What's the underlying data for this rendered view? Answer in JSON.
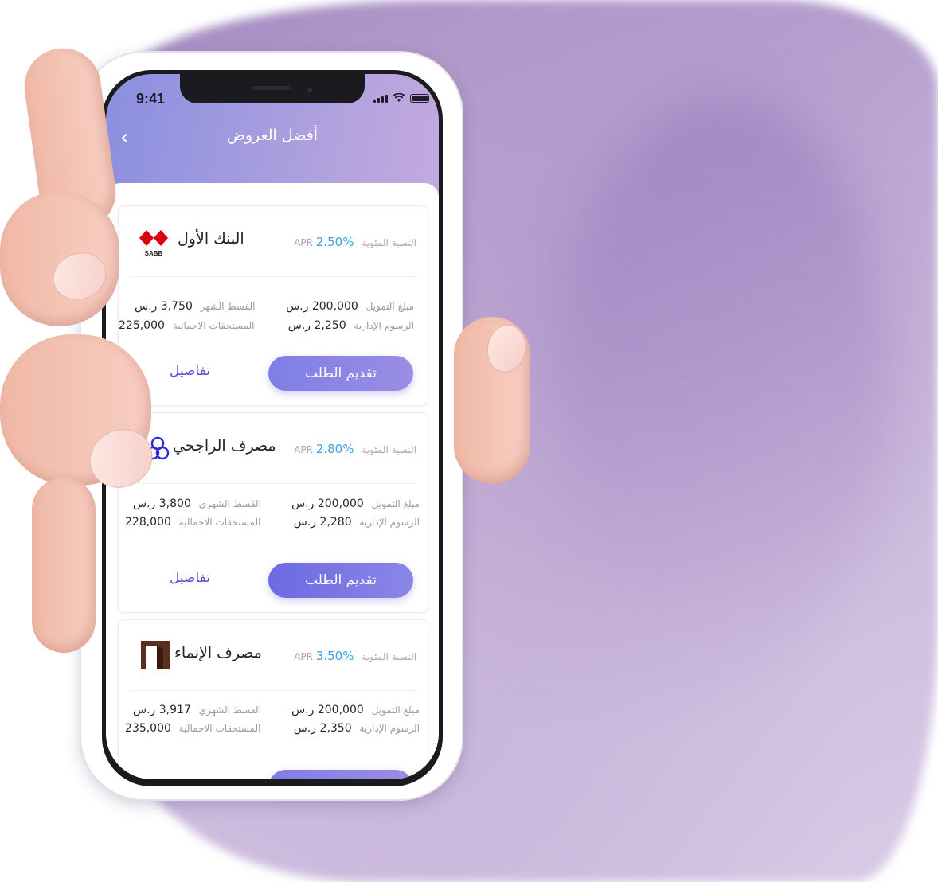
{
  "status_bar": {
    "time": "9:41"
  },
  "header": {
    "title": "أفضل العروض"
  },
  "offers": [
    {
      "bank_name": "البنك الأول",
      "logo_text": "SABB",
      "logo_color": "#db0011",
      "apr_label": "النسبة المئوية APR",
      "apr_value": "2.50%",
      "finance_label": "مبلغ التمويل",
      "finance_value": "200,000 ر.س",
      "admin_fee_label": "الرسوم الإدارية",
      "admin_fee_value": "2,250 ر.س",
      "monthly_label": "القسط الشهر",
      "monthly_value": "3,750 ر.س",
      "total_label": "المستحقات الاجمالية",
      "total_value": "225,000",
      "apply_label": "تقديم الطلب",
      "details_label": "تفاصيل"
    },
    {
      "bank_name": "مصرف الراجحي",
      "logo_color": "#2b2ad6",
      "apr_label": "النسبة المئوية APR",
      "apr_value": "2.80%",
      "finance_label": "مبلغ التمويل",
      "finance_value": "200,000 ر.س",
      "admin_fee_label": "الرسوم الإدارية",
      "admin_fee_value": "2,280 ر.س",
      "monthly_label": "القسط الشهري",
      "monthly_value": "3,800 ر.س",
      "total_label": "المستحقات الاجمالية",
      "total_value": "228,000",
      "apply_label": "تقديم الطلب",
      "details_label": "تفاصيل"
    },
    {
      "bank_name": "مصرف الإنماء",
      "logo_color": "#5c2e1f",
      "apr_label": "النسبة المئوية APR",
      "apr_value": "3.50%",
      "finance_label": "مبلغ التمويل",
      "finance_value": "200,000 ر.س",
      "admin_fee_label": "الرسوم الإدارية",
      "admin_fee_value": "2,350 ر.س",
      "monthly_label": "القسط الشهري",
      "monthly_value": "3,917 ر.س",
      "total_label": "المستحقات الاجمالية",
      "total_value": "235,000"
    }
  ],
  "colors": {
    "accent": "#7f7ee6",
    "apr": "#3aa0e8",
    "details_link": "#5a4fd8"
  }
}
